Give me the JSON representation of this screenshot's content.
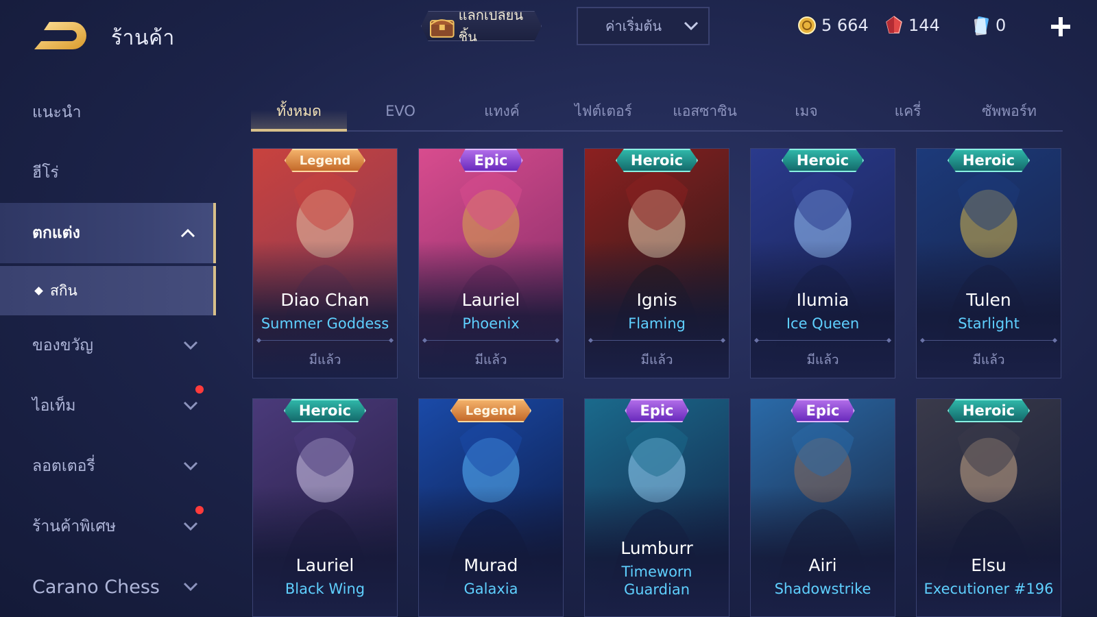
{
  "header": {
    "title": "ร้านค้า",
    "exchange_label": "แลกเปลี่ยนชิ้น",
    "sort_label": "ค่าเริ่มต้น",
    "currencies": [
      {
        "name": "gold",
        "value": "5 664",
        "icon": "gold-coin-icon",
        "color": "#e8b33c"
      },
      {
        "name": "ruby",
        "value": "144",
        "icon": "ruby-gem-icon",
        "color": "#e04848"
      },
      {
        "name": "card",
        "value": "0",
        "icon": "skin-card-icon",
        "color": "#5ab8ff"
      }
    ]
  },
  "sidebar": {
    "items": [
      {
        "label": "แนะนำ"
      },
      {
        "label": "ฮีโร่"
      },
      {
        "label": "ตกแต่ง",
        "expanded": true
      },
      {
        "label": "สกิน",
        "sub": true
      },
      {
        "label": "ของขวัญ"
      },
      {
        "label": "ไอเท็ม",
        "notification": true
      },
      {
        "label": "ลอตเตอรี่"
      },
      {
        "label": "ร้านค้าพิเศษ",
        "notification": true
      },
      {
        "label": "Carano Chess"
      }
    ]
  },
  "tabs": [
    {
      "label": "ทั้งหมด",
      "active": true
    },
    {
      "label": "EVO"
    },
    {
      "label": "แทงค์"
    },
    {
      "label": "ไฟต์เตอร์"
    },
    {
      "label": "แอสซาซิน"
    },
    {
      "label": "เมจ"
    },
    {
      "label": "แครี่"
    },
    {
      "label": "ซัพพอร์ท"
    }
  ],
  "cards": [
    {
      "rarity": "Legend",
      "hero": "Diao Chan",
      "skin": "Summer Goddess",
      "status": "มีแล้ว",
      "art": [
        "#c8423e",
        "#8a3a55",
        "#e6c4a8"
      ]
    },
    {
      "rarity": "Epic",
      "hero": "Lauriel",
      "skin": "Phoenix",
      "status": "มีแล้ว",
      "art": [
        "#d84c8e",
        "#8a2f6a",
        "#d8a84a"
      ]
    },
    {
      "rarity": "Heroic",
      "hero": "Ignis",
      "skin": "Flaming",
      "status": "มีแล้ว",
      "art": [
        "#8c2020",
        "#2e1a1a",
        "#e8d4b4"
      ]
    },
    {
      "rarity": "Heroic",
      "hero": "Ilumia",
      "skin": "Ice Queen",
      "status": "มีแล้ว",
      "art": [
        "#2a3a8c",
        "#1a2456",
        "#9cc8ff"
      ]
    },
    {
      "rarity": "Heroic",
      "hero": "Tulen",
      "skin": "Starlight",
      "status": "มีแล้ว",
      "art": [
        "#1c3a7a",
        "#18244c",
        "#d8b84a"
      ]
    },
    {
      "rarity": "Heroic",
      "hero": "Lauriel",
      "skin": "Black Wing",
      "status": "",
      "art": [
        "#4a3a7a",
        "#2a2048",
        "#d8d0f0"
      ]
    },
    {
      "rarity": "Legend",
      "hero": "Murad",
      "skin": "Galaxia",
      "status": "",
      "art": [
        "#1a4aa8",
        "#0e1e4c",
        "#5ab8ff"
      ]
    },
    {
      "rarity": "Epic",
      "hero": "Lumburr",
      "skin": "Timeworn Guardian",
      "status": "",
      "art": [
        "#1a6a8c",
        "#14284c",
        "#9ad8ff"
      ]
    },
    {
      "rarity": "Epic",
      "hero": "Airi",
      "skin": "Shadowstrike",
      "status": "",
      "art": [
        "#2a6aa8",
        "#1a2a48",
        "#8a6a5a"
      ]
    },
    {
      "rarity": "Heroic",
      "hero": "Elsu",
      "skin": "Executioner #196",
      "status": "",
      "art": [
        "#3a3a4a",
        "#1a2038",
        "#c8a888"
      ]
    }
  ]
}
